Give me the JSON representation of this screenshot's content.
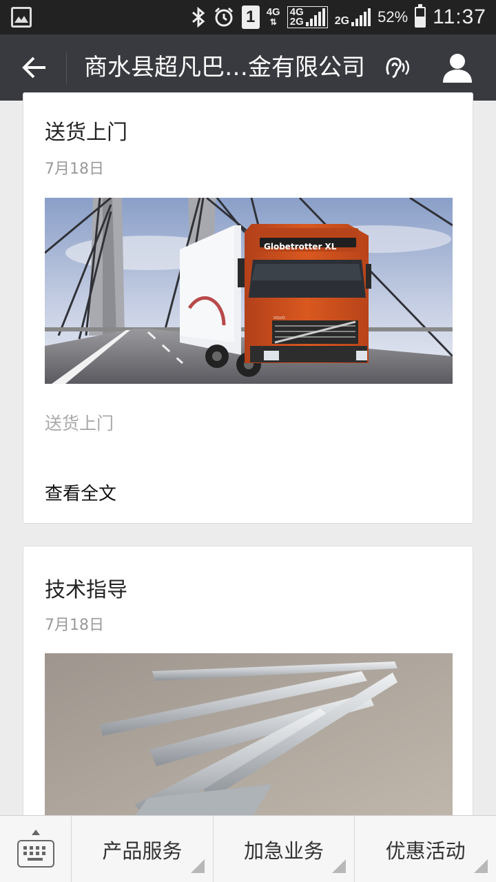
{
  "status_bar": {
    "network_4g": "4G",
    "network_4g2g_top": "4G",
    "network_4g2g_bottom": "2G",
    "network_2g": "2G",
    "sim_label": "1",
    "battery_percent": "52%",
    "battery_level": 0.52,
    "time": "11:37"
  },
  "title_bar": {
    "title": "商水县超凡巴…金有限公司"
  },
  "articles": [
    {
      "title": "送货上门",
      "date": "7月18日",
      "image_caption": "Globetrotter XL",
      "image_brand": "VOLVO",
      "summary": "送货上门",
      "read_more": "查看全文"
    },
    {
      "title": "技术指导",
      "date": "7月18日"
    }
  ],
  "bottom_menu": {
    "items": [
      {
        "label": "产品服务"
      },
      {
        "label": "加急业务"
      },
      {
        "label": "优惠活动"
      }
    ]
  },
  "colors": {
    "status_bar_bg": "#222222",
    "title_bar_bg": "#393a3f",
    "page_bg": "#ececec",
    "truck_orange": "#d2541f"
  }
}
